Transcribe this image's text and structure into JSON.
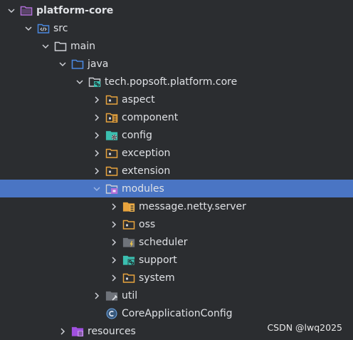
{
  "colors": {
    "background": "#2b2d30",
    "selection": "#4a75c4",
    "text": "#dfe1e5",
    "folder_stroke": "#ced0d6",
    "package_orange": "#e8a33d",
    "module_purple": "#b16fd8",
    "resources_purple": "#a050e0",
    "source_blue": "#4a88e0",
    "teal": "#3bbfb0",
    "class_blue": "#4a8fd6"
  },
  "tree": {
    "items": [
      {
        "label": "platform-core",
        "icon": "module-folder-icon",
        "expanded": true
      },
      {
        "label": "src",
        "icon": "source-folder-icon",
        "expanded": true
      },
      {
        "label": "main",
        "icon": "folder-icon",
        "expanded": true
      },
      {
        "label": "java",
        "icon": "source-root-folder-icon",
        "expanded": true
      },
      {
        "label": "tech.popsoft.platform.core",
        "icon": "package-module-icon",
        "expanded": true
      },
      {
        "label": "aspect",
        "icon": "package-folder-icon",
        "expanded": false
      },
      {
        "label": "component",
        "icon": "component-package-icon",
        "expanded": false
      },
      {
        "label": "config",
        "icon": "config-package-icon",
        "expanded": false
      },
      {
        "label": "exception",
        "icon": "package-folder-icon",
        "expanded": false
      },
      {
        "label": "extension",
        "icon": "package-folder-icon",
        "expanded": false
      },
      {
        "label": "modules",
        "icon": "modules-package-icon",
        "expanded": true,
        "selected": true
      },
      {
        "label": "message.netty.server",
        "icon": "message-package-icon",
        "expanded": false
      },
      {
        "label": "oss",
        "icon": "package-folder-icon",
        "expanded": false
      },
      {
        "label": "scheduler",
        "icon": "scheduler-package-icon",
        "expanded": false
      },
      {
        "label": "support",
        "icon": "support-package-icon",
        "expanded": false
      },
      {
        "label": "system",
        "icon": "package-folder-icon",
        "expanded": false
      },
      {
        "label": "util",
        "icon": "util-package-icon",
        "expanded": false
      },
      {
        "label": "CoreApplicationConfig",
        "icon": "class-icon"
      },
      {
        "label": "resources",
        "icon": "resources-folder-icon",
        "expanded": false
      }
    ]
  },
  "watermark": "CSDN @lwq2025"
}
